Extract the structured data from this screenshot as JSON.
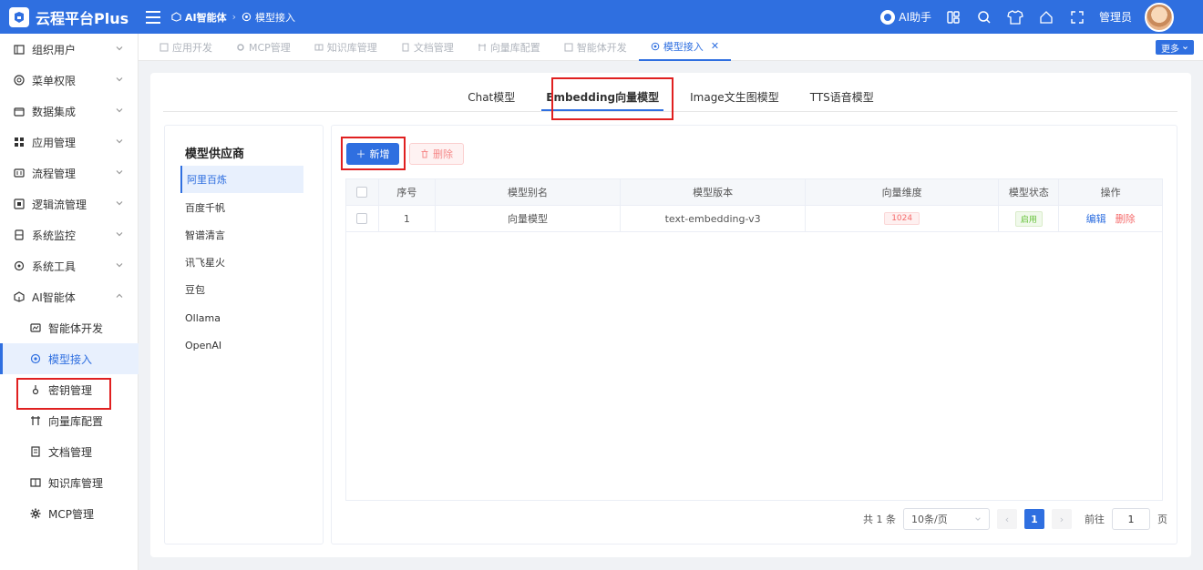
{
  "header": {
    "brand": "云程平台Plus",
    "breadcrumb": [
      "AI智能体",
      "模型接入"
    ],
    "ai_assistant": "AI助手",
    "user": "管理员",
    "icons": [
      "layout-icon",
      "search-icon",
      "shirt-icon",
      "home-icon",
      "fullscreen-icon"
    ]
  },
  "sidebar": {
    "items": [
      {
        "label": "组织用户",
        "icon": "org-icon"
      },
      {
        "label": "菜单权限",
        "icon": "menu-icon"
      },
      {
        "label": "数据集成",
        "icon": "data-icon"
      },
      {
        "label": "应用管理",
        "icon": "app-icon"
      },
      {
        "label": "流程管理",
        "icon": "flow-icon"
      },
      {
        "label": "逻辑流管理",
        "icon": "logic-icon"
      },
      {
        "label": "系统监控",
        "icon": "monitor-icon"
      },
      {
        "label": "系统工具",
        "icon": "tools-icon"
      },
      {
        "label": "AI智能体",
        "icon": "ai-icon"
      }
    ],
    "sub_items": [
      {
        "label": "智能体开发",
        "icon": "agent-icon"
      },
      {
        "label": "模型接入",
        "icon": "model-icon"
      },
      {
        "label": "密钥管理",
        "icon": "key-icon"
      },
      {
        "label": "向量库配置",
        "icon": "vector-icon"
      },
      {
        "label": "文档管理",
        "icon": "doc-icon"
      },
      {
        "label": "知识库管理",
        "icon": "book-icon"
      },
      {
        "label": "MCP管理",
        "icon": "gear-icon"
      }
    ]
  },
  "page_tabs": {
    "items": [
      "应用开发",
      "MCP管理",
      "知识库管理",
      "文档管理",
      "向量库配置",
      "智能体开发",
      "模型接入"
    ],
    "more": "更多"
  },
  "model_tabs": [
    "Chat模型",
    "Embedding向量模型",
    "Image文生图模型",
    "TTS语音模型"
  ],
  "providers": {
    "title": "模型供应商",
    "items": [
      "阿里百炼",
      "百度千帆",
      "智谱清言",
      "讯飞星火",
      "豆包",
      "Ollama",
      "OpenAI"
    ]
  },
  "toolbar": {
    "add": "新增",
    "delete": "删除"
  },
  "table": {
    "headers": [
      "序号",
      "模型别名",
      "模型版本",
      "向量维度",
      "模型状态",
      "操作"
    ],
    "rows": [
      {
        "index": "1",
        "alias": "向量模型",
        "version": "text-embedding-v3",
        "dimension": "1024",
        "status": "启用",
        "edit": "编辑",
        "delete": "删除"
      }
    ]
  },
  "pagination": {
    "total_prefix": "共",
    "total": "1",
    "total_suffix": "条",
    "page_size": "10条/页",
    "current_page": "1",
    "goto_label": "前往",
    "goto_value": "1",
    "page_suffix": "页"
  },
  "colors": {
    "primary": "#2f6fe0",
    "danger": "#f56c6c",
    "success": "#67c23a",
    "highlight": "#e02020"
  }
}
